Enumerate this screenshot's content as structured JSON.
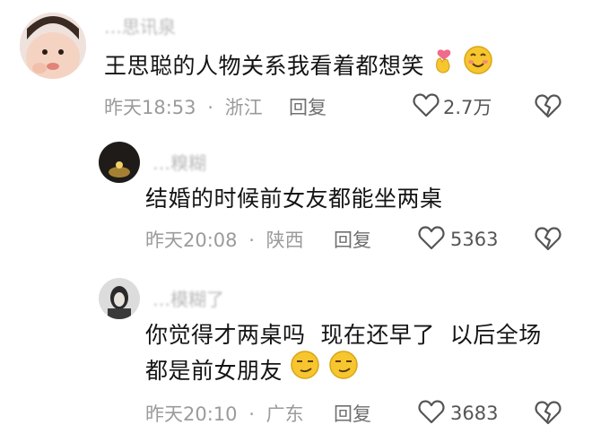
{
  "comments": [
    {
      "username": "…思讯泉",
      "text": "王思聪的人物关系我看着都想笑",
      "emojis": [
        "finger-heart-emoji",
        "smiling-face-emoji"
      ],
      "time": "昨天18:53",
      "dot": "·",
      "location": "浙江",
      "reply_label": "回复",
      "likes": "2.7万"
    },
    {
      "username": "…糗糊",
      "text": "结婚的时候前女友都能坐两桌",
      "time": "昨天20:08",
      "dot": "·",
      "location": "陕西",
      "reply_label": "回复",
      "likes": "5363"
    },
    {
      "username": "…模糊了",
      "text_line1": "你觉得才两桌吗  现在还早了  以后全场",
      "text_line2": "都是前女朋友",
      "emojis": [
        "smirking-face-emoji",
        "smirking-face-emoji"
      ],
      "time": "昨天20:10",
      "dot": "·",
      "location": "广东",
      "reply_label": "回复",
      "likes": "3683"
    }
  ],
  "colors": {
    "meta": "#9b9b9b",
    "username": "#b9b9b9",
    "text": "#141414",
    "emoji_yellow": "#f7c62f",
    "heart_pink": "#f06a8c"
  }
}
